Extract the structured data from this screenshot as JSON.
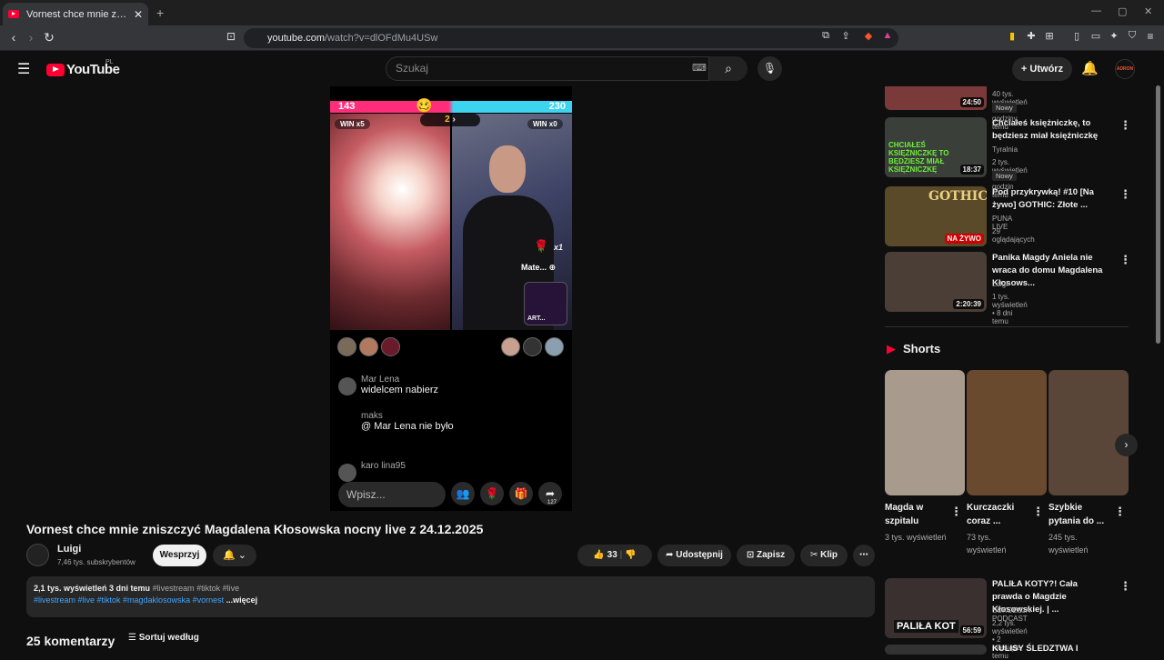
{
  "browser": {
    "tab_title": "Vornest chce mnie zniszczyć Magdalena Kłosowska nocny live z 24.12.2025 - YouTube",
    "url_host": "youtube.com",
    "url_path": "/watch?v=dlOFdMu4USw"
  },
  "header": {
    "logo": "YouTube",
    "country": "PL",
    "search_placeholder": "Szukaj",
    "create_label": "Utwórz",
    "avatar_text": "ADRON"
  },
  "player": {
    "score_left": "143",
    "score_right": "230",
    "win_left": "WIN x5",
    "win_right": "WIN x0",
    "pk_round": "2",
    "rose_count": "x1",
    "mate_label": "Mate...",
    "mini_label": "ART...",
    "chat": [
      {
        "user": "Mar Lena",
        "text": "widelcem nabierz"
      },
      {
        "user": "maks",
        "text": "@ Mar Lena nie było"
      },
      {
        "user": "karo lina95",
        "text": ""
      }
    ],
    "input_placeholder": "Wpisz...",
    "share_count": "127"
  },
  "video": {
    "title": "Vornest chce mnie zniszczyć Magdalena Kłosowska nocny live z 24.12.2025",
    "channel": "Luigi",
    "subscribers": "7,46 tys. subskrybentów",
    "support_label": "Wesprzyj",
    "likes": "33",
    "share_label": "Udostępnij",
    "save_label": "Zapisz",
    "clip_label": "Klip",
    "views_date": "2,1 tys. wyświetleń  3 dni temu",
    "tags_top": "#livestream #tiktok #live",
    "tags_bottom": "#livestream #live #tiktok #magdaklosowska #vornest",
    "more": "...więcej",
    "comments_count": "25 komentarzy",
    "sort_label": "Sortuj według"
  },
  "sidebar": {
    "videos": [
      {
        "title": "",
        "channel": "",
        "meta": "40 tys. wyświetleń • 4 godziny temu",
        "badge": "Nowy",
        "duration": "24:50",
        "color": "#7b3a3a"
      },
      {
        "title": "Chciałeś księżniczkę, to będziesz miał księżniczkę",
        "channel": "Tyralnia",
        "meta": "2 tys. wyświetleń • 12 godzin temu",
        "badge": "Nowy",
        "duration": "18:37",
        "color": "#3a3f3a"
      },
      {
        "title": "Pod przykrywką! #10 [Na żywo] GOTHIC: Złote ...",
        "channel": "PUNA LIVE",
        "meta": "29 oglądających",
        "badge": "",
        "duration": "NA ŻYWO",
        "color": "#5a4a2a"
      },
      {
        "title": "Panika Magdy Aniela nie wraca do domu Magdalena Kłosows...",
        "channel": "Luigi",
        "meta": "1 tys. wyświetleń • 8 dni temu",
        "badge": "",
        "duration": "2:20:39",
        "color": "#4a3e36"
      },
      {
        "title": "PALIŁA KOTY?! Cała prawda o Magdzie Kłosowskiej. | ...",
        "channel": "SUKCESJA PODCAST",
        "meta": "2,2 tys. wyświetleń • 2 miesiące temu",
        "badge": "",
        "duration": "56:59",
        "color": "#3a3030"
      },
      {
        "title": "KULISY ŚLEDZTWA I PRAWDA",
        "channel": "",
        "meta": "",
        "badge": "",
        "duration": "",
        "color": "#333"
      }
    ],
    "thumb_text_1": "CHCIAŁEŚ KSIĘŻNICZKĘ TO BĘDZIESZ MIAŁ KSIĘŻNICZKĘ",
    "thumb_text_2": "GOTHIC",
    "thumb_text_5": "PALIŁA KOT",
    "shorts_heading": "Shorts",
    "shorts": [
      {
        "title": "Magda w szpitalu",
        "views": "3 tys. wyświetleń",
        "color": "#a89a8c"
      },
      {
        "title": "Kurczaczki coraz ...",
        "views": "73 tys. wyświetleń",
        "color": "#6a4a2e"
      },
      {
        "title": "Szybkie pytania do ...",
        "views": "245 tys. wyświetleń",
        "color": "#5a4638"
      }
    ]
  },
  "colors": {
    "bg": "#0f0f0f",
    "accent_red": "#ff0033",
    "link_blue": "#3ea6ff",
    "pk_pink": "#ff2d7a",
    "pk_cyan": "#3dd4f0"
  }
}
